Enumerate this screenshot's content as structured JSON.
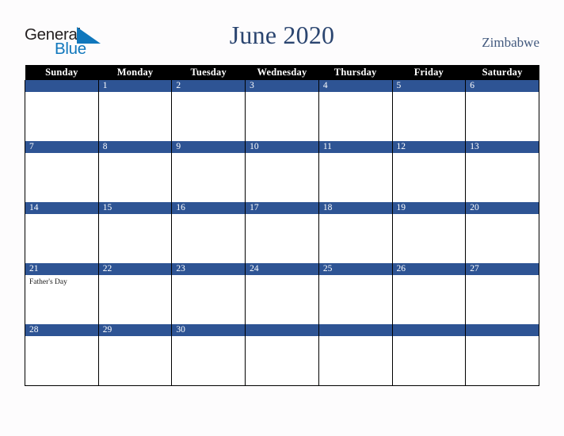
{
  "branding": {
    "logo_word_1": "General",
    "logo_word_2": "Blue",
    "logo_triangle_color": "#1077bc",
    "logo_word_1_color": "#231f20",
    "logo_word_2_color": "#1077bc"
  },
  "header": {
    "title": "June 2020",
    "country": "Zimbabwe",
    "title_color": "#2b4570",
    "country_color": "#42597e"
  },
  "theme": {
    "page_background": "#fdfcfd",
    "header_row_background": "#000000",
    "header_row_text": "#ffffff",
    "date_bar_background": "#2e5494",
    "date_bar_text": "#ffffff",
    "cell_background": "#ffffff",
    "grid_line": "#000000"
  },
  "calendar": {
    "weekday_headers": [
      "Sunday",
      "Monday",
      "Tuesday",
      "Wednesday",
      "Thursday",
      "Friday",
      "Saturday"
    ],
    "weeks": [
      [
        {
          "date": "",
          "events": []
        },
        {
          "date": "1",
          "events": []
        },
        {
          "date": "2",
          "events": []
        },
        {
          "date": "3",
          "events": []
        },
        {
          "date": "4",
          "events": []
        },
        {
          "date": "5",
          "events": []
        },
        {
          "date": "6",
          "events": []
        }
      ],
      [
        {
          "date": "7",
          "events": []
        },
        {
          "date": "8",
          "events": []
        },
        {
          "date": "9",
          "events": []
        },
        {
          "date": "10",
          "events": []
        },
        {
          "date": "11",
          "events": []
        },
        {
          "date": "12",
          "events": []
        },
        {
          "date": "13",
          "events": []
        }
      ],
      [
        {
          "date": "14",
          "events": []
        },
        {
          "date": "15",
          "events": []
        },
        {
          "date": "16",
          "events": []
        },
        {
          "date": "17",
          "events": []
        },
        {
          "date": "18",
          "events": []
        },
        {
          "date": "19",
          "events": []
        },
        {
          "date": "20",
          "events": []
        }
      ],
      [
        {
          "date": "21",
          "events": [
            "Father's Day"
          ]
        },
        {
          "date": "22",
          "events": []
        },
        {
          "date": "23",
          "events": []
        },
        {
          "date": "24",
          "events": []
        },
        {
          "date": "25",
          "events": []
        },
        {
          "date": "26",
          "events": []
        },
        {
          "date": "27",
          "events": []
        }
      ],
      [
        {
          "date": "28",
          "events": []
        },
        {
          "date": "29",
          "events": []
        },
        {
          "date": "30",
          "events": []
        },
        {
          "date": "",
          "events": []
        },
        {
          "date": "",
          "events": []
        },
        {
          "date": "",
          "events": []
        },
        {
          "date": "",
          "events": []
        }
      ]
    ]
  }
}
